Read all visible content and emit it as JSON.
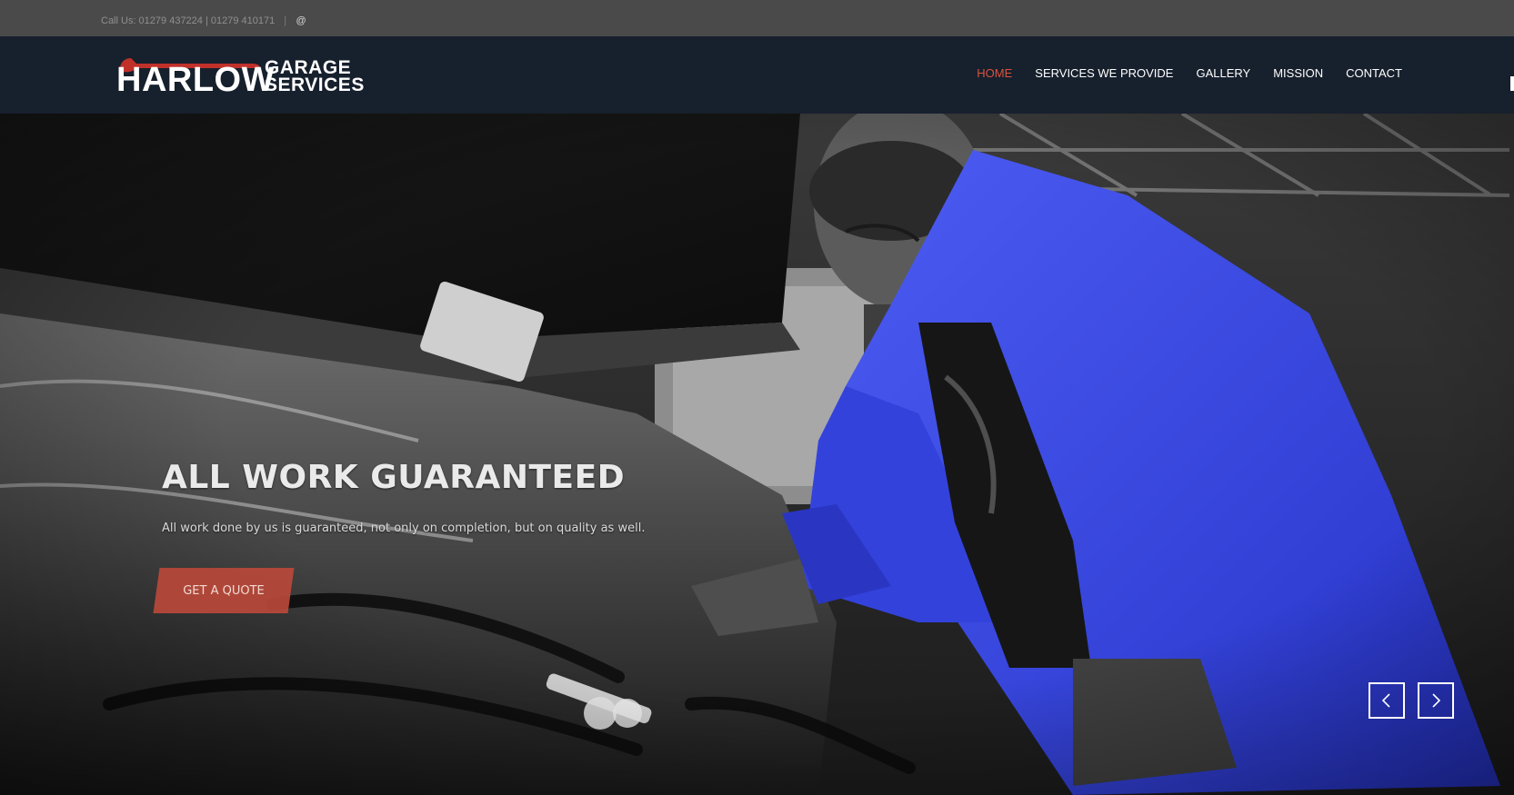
{
  "topbar": {
    "contact_text": "Call Us: 01279 437224 | 01279 410171",
    "separator": "|",
    "email_icon": "at-sign-icon"
  },
  "brand": {
    "name_primary": "HARLOW",
    "name_line1": "GARAGE",
    "name_line2": "SERVICES",
    "accent_color": "#d9533f"
  },
  "nav": {
    "items": [
      {
        "label": "HOME",
        "active": true
      },
      {
        "label": "SERVICES WE PROVIDE",
        "active": false
      },
      {
        "label": "GALLERY",
        "active": false
      },
      {
        "label": "MISSION",
        "active": false
      },
      {
        "label": "CONTACT",
        "active": false
      }
    ]
  },
  "hero": {
    "title": "ALL WORK GUARANTEED",
    "subtitle": "All work done by us is guaranteed, not only on completion, but on quality as well.",
    "cta_label": "GET A QUOTE",
    "image_description_icon": "mechanic-photo",
    "prev_icon": "chevron-left-icon",
    "next_icon": "chevron-right-icon",
    "highlight_color": "#3a48e0"
  },
  "colors": {
    "topbar_bg": "#4a4a4a",
    "navbar_bg": "#17202d",
    "cta_bg": "#b9493a"
  }
}
